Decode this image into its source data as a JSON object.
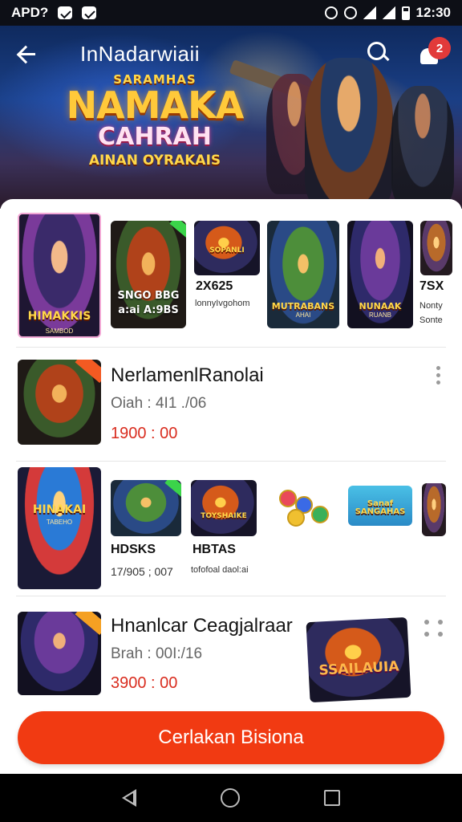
{
  "status_bar": {
    "app_label": "APD?",
    "time": "12:30"
  },
  "header": {
    "title": "InNadarwiaii",
    "notification_count": "2"
  },
  "hero": {
    "logo_top": "SARAMHAS",
    "logo_main": "NAMAKA",
    "logo_mid": "CAHRAH",
    "logo_bottom": "AINAN OYRAKAIS"
  },
  "featured_row": {
    "tiles": [
      {
        "art_title": "HIMAKKIS",
        "art_sub": "SAMBOD"
      },
      {
        "label": "SNGO BBG",
        "sub": "a:ai A:9BS"
      },
      {
        "art_title": "SOPANLI",
        "label": "2X625",
        "sub": "lonnyIvgohom"
      },
      {
        "art_title": "MUTRABANS",
        "art_sub": "AHAI"
      },
      {
        "art_title": "NUNAAK",
        "art_sub": "RUANB"
      },
      {
        "label": "7SX",
        "sub": "Nonty Sonte"
      }
    ]
  },
  "list_items": [
    {
      "title": "NerlamenlRanolai",
      "meta": "Oiah : 4I1 ./06",
      "price": "1900 : 00"
    },
    {
      "title": "Hnanlcar Ceagjalraar",
      "meta": "Brah : 00I:/16",
      "price": "3900 : 00"
    }
  ],
  "promo_row": {
    "poster_title": "HINAKAI",
    "poster_sub": "TABEHO",
    "labels": [
      {
        "label": "HDSKS",
        "sub": "17/905 ; 007"
      },
      {
        "art_title": "TOYSHAIKE",
        "label": "HBTAS",
        "sub": "tofofoal daol:ai"
      },
      {
        "art_title": "Sanaf SANGAHAS"
      }
    ]
  },
  "feature_card": {
    "art_title": "SSAILAUIA"
  },
  "cta": {
    "label": "Cerlakan Bisiona"
  },
  "colors": {
    "accent": "#f13a12",
    "price": "#d92d1f",
    "status_bg": "#0d0f16"
  }
}
